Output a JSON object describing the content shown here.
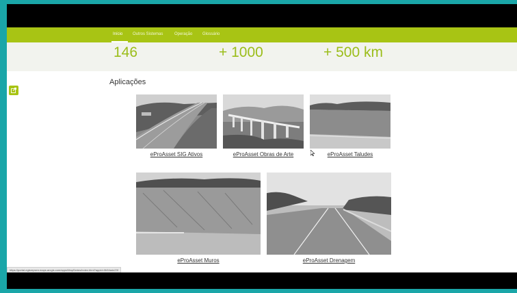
{
  "nav": {
    "items": [
      {
        "label": "Início",
        "active": true
      },
      {
        "label": "Outros Sistemas"
      },
      {
        "label": "Operação"
      },
      {
        "label": "Glossário"
      }
    ]
  },
  "stats": [
    "146",
    "+ 1000",
    "+ 500 km"
  ],
  "section": {
    "title": "Aplicações"
  },
  "apps": [
    {
      "label": "eProAsset SIG Ativos"
    },
    {
      "label": "eProAsset Obras de Arte"
    },
    {
      "label": "eProAsset Taludes"
    },
    {
      "label": "eProAsset Muros"
    },
    {
      "label": "eProAsset Drenagem"
    }
  ],
  "status_url": "https://portal-egisrepsen.maps.arcgis.com/apps/MapSeries/index.html?appid=0b54adc23f",
  "colors": {
    "accent": "#a8c414",
    "stat_text": "#9bbd1a",
    "frame": "#1aa6a8"
  },
  "icons": [
    "sidebar-app-icon"
  ]
}
